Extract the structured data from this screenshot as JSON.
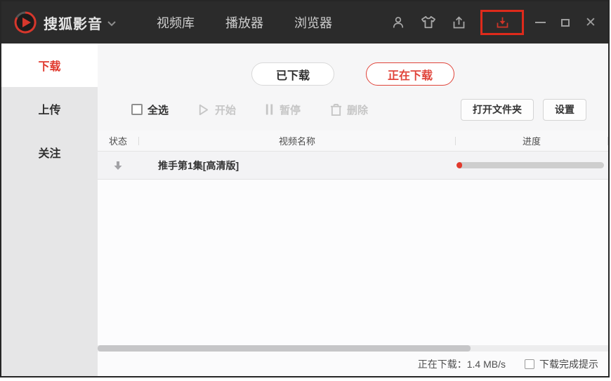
{
  "titlebar": {
    "app_title": "搜狐影音",
    "nav": [
      {
        "label": "视频库"
      },
      {
        "label": "播放器"
      },
      {
        "label": "浏览器"
      }
    ],
    "icons": [
      "user-icon",
      "skin-icon",
      "upload-icon",
      "download-icon"
    ],
    "close_glyph": "✕"
  },
  "sidebar": {
    "items": [
      {
        "label": "下载",
        "active": true
      },
      {
        "label": "上传",
        "active": false
      },
      {
        "label": "关注",
        "active": false
      }
    ]
  },
  "tabs": [
    {
      "label": "已下载",
      "active": false
    },
    {
      "label": "正在下载",
      "active": true
    }
  ],
  "toolbar": {
    "select_all": "全选",
    "start": "开始",
    "pause": "暂停",
    "delete": "删除",
    "open_folder": "打开文件夹",
    "settings": "设置"
  },
  "table": {
    "columns": [
      "状态",
      "视频名称",
      "进度"
    ],
    "rows": [
      {
        "status_icon": "downloading-arrow",
        "name": "推手第1集[高清版]",
        "progress_percent": 4
      }
    ]
  },
  "statusbar": {
    "download_status": "正在下载：1.4 MB/s",
    "notify_label": "下载完成提示"
  },
  "colors": {
    "accent_red": "#e0392e",
    "titlebar_bg": "#2b2b2b",
    "annotation_red": "#de2a1b",
    "sidebar_bg": "#e6e6e7"
  }
}
